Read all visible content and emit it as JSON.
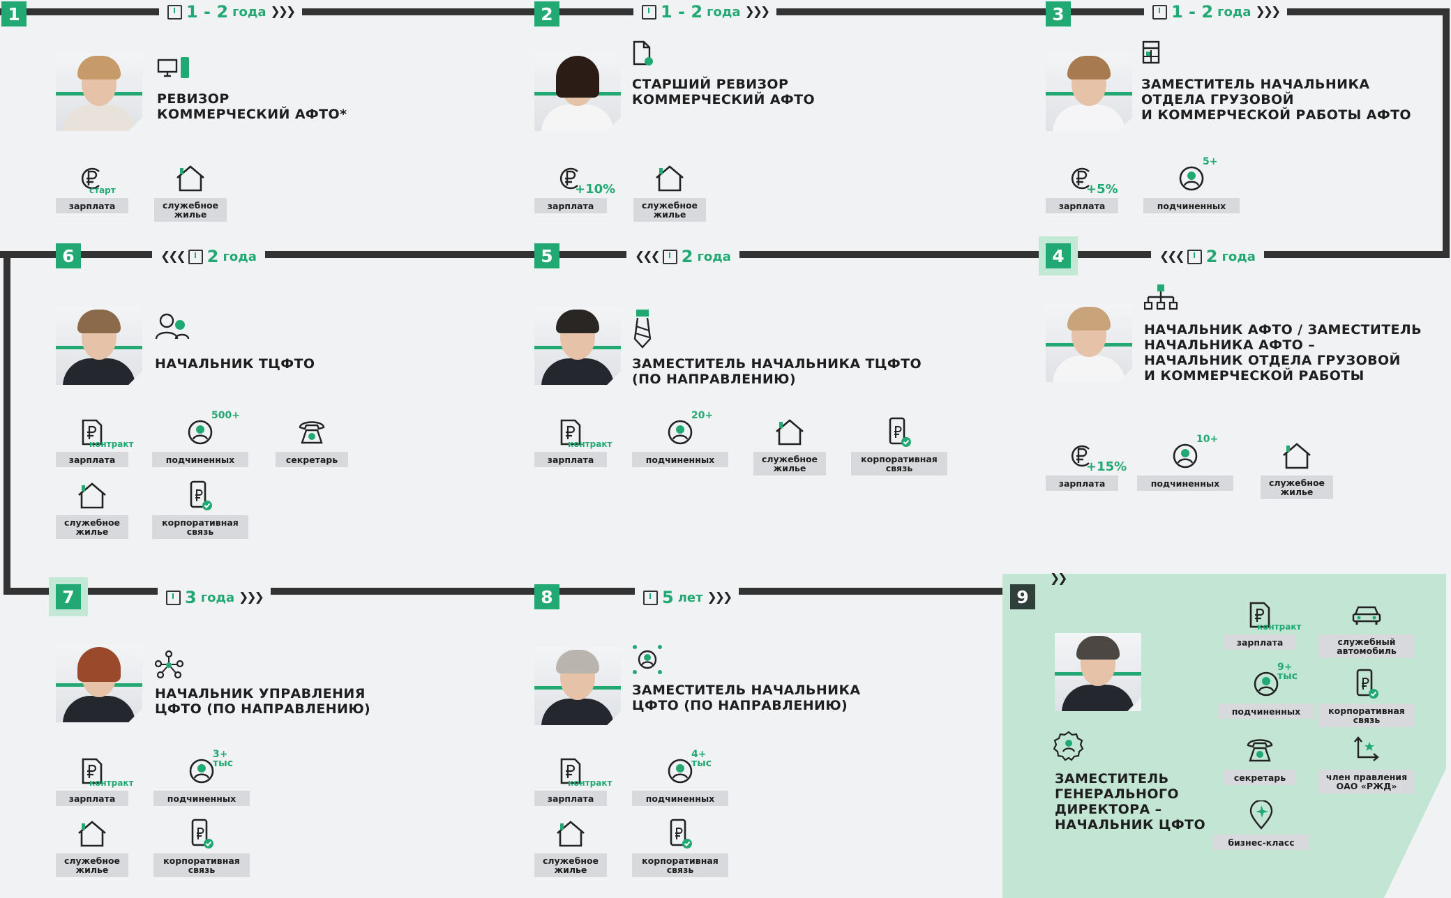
{
  "colors": {
    "accent": "#22a872",
    "track": "#333333",
    "highlight": "#c3e6d4",
    "label_bg": "#d7d9dc"
  },
  "stages": [
    {
      "number": "1",
      "duration": "1 - 2",
      "unit": "года",
      "title": "РЕВИЗОР\nКОММЕРЧЕСКИЙ АФТО*",
      "title_icon": "computer-phone-icon",
      "benefits": [
        {
          "icon": "ruble-icon",
          "badge": "старт",
          "label": "зарплата"
        },
        {
          "icon": "house-icon",
          "badge": "",
          "label": "служебное жилье"
        }
      ]
    },
    {
      "number": "2",
      "duration": "1 - 2",
      "unit": "года",
      "title": "СТАРШИЙ РЕВИЗОР\nКОММЕРЧЕСКИЙ АФТО",
      "title_icon": "document-icon",
      "benefits": [
        {
          "icon": "ruble-icon",
          "badge": "+10%",
          "label": "зарплата"
        },
        {
          "icon": "house-icon",
          "badge": "",
          "label": "служебное жилье"
        }
      ]
    },
    {
      "number": "3",
      "duration": "1 - 2",
      "unit": "года",
      "title": "ЗАМЕСТИТЕЛЬ НАЧАЛЬНИКА\nОТДЕЛА ГРУЗОВОЙ\nИ КОММЕРЧЕСКОЙ РАБОТЫ АФТО",
      "title_icon": "calculator-icon",
      "benefits": [
        {
          "icon": "ruble-icon",
          "badge": "+5%",
          "label": "зарплата"
        },
        {
          "icon": "person-icon",
          "badge": "5+",
          "label": "подчиненных"
        }
      ]
    },
    {
      "number": "4",
      "duration": "2",
      "unit": "года",
      "title": "НАЧАЛЬНИК АФТО / ЗАМЕСТИТЕЛЬ\nНАЧАЛЬНИКА АФТО –\nНАЧАЛЬНИК ОТДЕЛА ГРУЗОВОЙ\nИ КОММЕРЧЕСКОЙ РАБОТЫ",
      "title_icon": "org-chart-icon",
      "benefits": [
        {
          "icon": "ruble-icon",
          "badge": "+15%",
          "label": "зарплата"
        },
        {
          "icon": "person-icon",
          "badge": "10+",
          "label": "подчиненных"
        },
        {
          "icon": "house-icon",
          "badge": "",
          "label": "служебное жилье"
        }
      ]
    },
    {
      "number": "5",
      "duration": "2",
      "unit": "года",
      "title": "ЗАМЕСТИТЕЛЬ НАЧАЛЬНИКА ТЦФТО\n(ПО НАПРАВЛЕНИЮ)",
      "title_icon": "tie-icon",
      "benefits": [
        {
          "icon": "contract-icon",
          "badge": "контракт",
          "label": "зарплата"
        },
        {
          "icon": "person-icon",
          "badge": "20+",
          "label": "подчиненных"
        },
        {
          "icon": "house-icon",
          "badge": "",
          "label": "служебное жилье"
        },
        {
          "icon": "phone-icon",
          "badge": "",
          "label": "корпоративная связь"
        }
      ]
    },
    {
      "number": "6",
      "duration": "2",
      "unit": "года",
      "title": "НАЧАЛЬНИК ТЦФТО",
      "title_icon": "people-icon",
      "benefits": [
        {
          "icon": "contract-icon",
          "badge": "контракт",
          "label": "зарплата"
        },
        {
          "icon": "person-icon",
          "badge": "500+",
          "label": "подчиненных"
        },
        {
          "icon": "telephone-icon",
          "badge": "",
          "label": "секретарь"
        },
        {
          "icon": "house-icon",
          "badge": "",
          "label": "служебное жилье"
        },
        {
          "icon": "phone-icon",
          "badge": "",
          "label": "корпоративная связь"
        }
      ]
    },
    {
      "number": "7",
      "duration": "3",
      "unit": "года",
      "title": "НАЧАЛЬНИК УПРАВЛЕНИЯ\nЦФТО (ПО НАПРАВЛЕНИЮ)",
      "title_icon": "network-icon",
      "benefits": [
        {
          "icon": "contract-icon",
          "badge": "контракт",
          "label": "зарплата"
        },
        {
          "icon": "person-icon",
          "badge": "3+\nтыс",
          "label": "подчиненных"
        },
        {
          "icon": "house-icon",
          "badge": "",
          "label": "служебное жилье"
        },
        {
          "icon": "phone-icon",
          "badge": "",
          "label": "корпоративная связь"
        }
      ]
    },
    {
      "number": "8",
      "duration": "5",
      "unit": "лет",
      "title": "ЗАМЕСТИТЕЛЬ НАЧАЛЬНИКА\nЦФТО (ПО НАПРАВЛЕНИЮ)",
      "title_icon": "focus-person-icon",
      "benefits": [
        {
          "icon": "contract-icon",
          "badge": "контракт",
          "label": "зарплата"
        },
        {
          "icon": "person-icon",
          "badge": "4+\nтыс",
          "label": "подчиненных"
        },
        {
          "icon": "house-icon",
          "badge": "",
          "label": "служебное жилье"
        },
        {
          "icon": "phone-icon",
          "badge": "",
          "label": "корпоративная связь"
        }
      ]
    },
    {
      "number": "9",
      "title": "ЗАМЕСТИТЕЛЬ\nГЕНЕРАЛЬНОГО\nДИРЕКТОРА –\nНАЧАЛЬНИК ЦФТО",
      "title_icon": "badge-person-icon",
      "benefits": [
        {
          "icon": "contract-icon",
          "badge": "контракт",
          "label": "зарплата"
        },
        {
          "icon": "car-icon",
          "badge": "",
          "label": "служебный автомобиль"
        },
        {
          "icon": "person-icon",
          "badge": "9+\nтыс",
          "label": "подчиненных"
        },
        {
          "icon": "phone-icon",
          "badge": "",
          "label": "корпоративная связь"
        },
        {
          "icon": "telephone-icon",
          "badge": "",
          "label": "секретарь"
        },
        {
          "icon": "star-arrow-icon",
          "badge": "",
          "label": "член правления ОАО «РЖД»"
        },
        {
          "icon": "plane-pin-icon",
          "badge": "",
          "label": "бизнес-класс"
        }
      ]
    }
  ]
}
